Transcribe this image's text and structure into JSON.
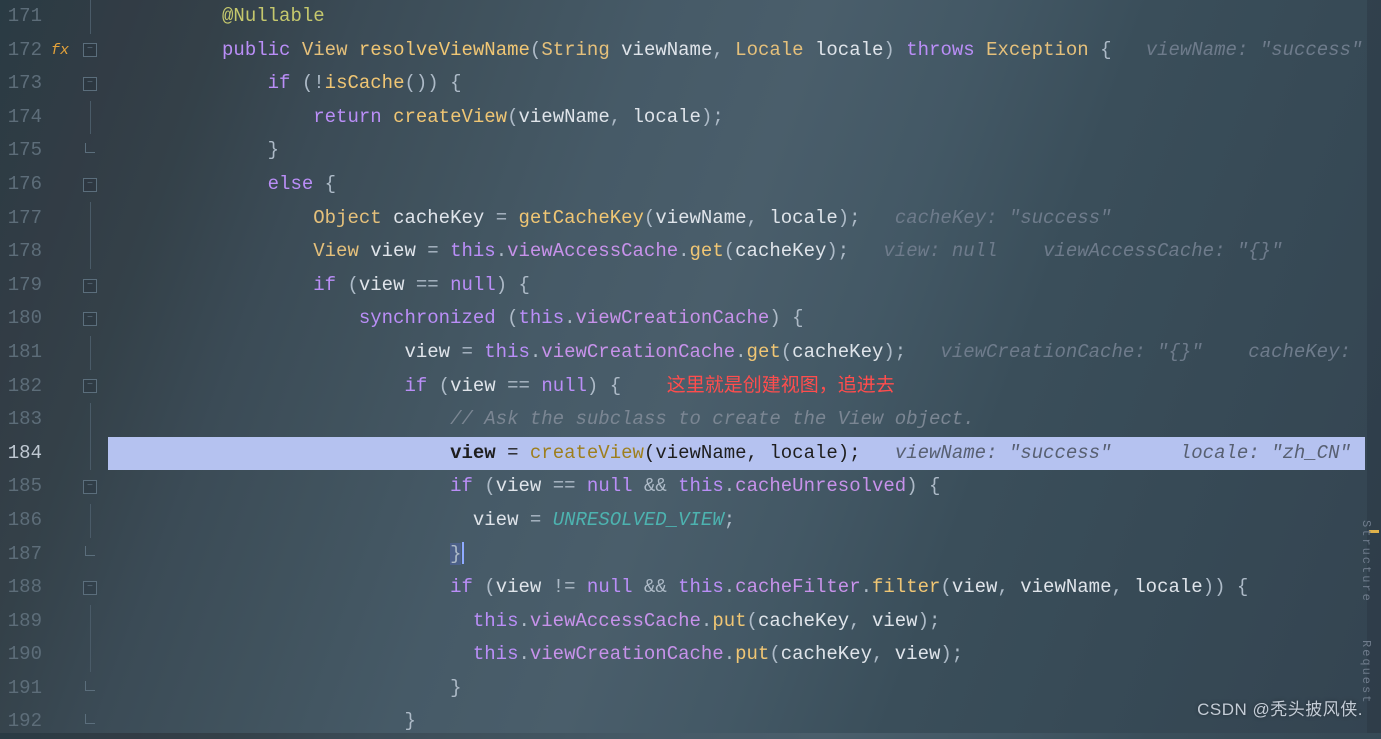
{
  "lines": [
    {
      "num": "171",
      "fold": "",
      "icon": "",
      "code_html": "          <span class='ann'>@Nullable</span>"
    },
    {
      "num": "172",
      "fold": "box",
      "icon": "fx",
      "code_html": "          <span class='kw'>public</span> <span class='type'>View</span> <span class='fn'>resolveViewName</span><span class='pun'>(</span><span class='type'>String</span> <span class='param'>viewName</span><span class='pun'>,</span> <span class='type'>Locale</span> <span class='param'>locale</span><span class='pun'>)</span> <span class='kw'>throws</span> <span class='type'>Exception</span> <span class='pun'>{</span>   <span class='hint'>viewName: &quot;success&quot;</span>"
    },
    {
      "num": "173",
      "fold": "box",
      "icon": "",
      "code_html": "              <span class='kw'>if</span> <span class='pun'>(!</span><span class='fn'>isCache</span><span class='pun'>()) {</span>"
    },
    {
      "num": "174",
      "fold": "",
      "icon": "",
      "code_html": "                  <span class='kw'>return</span> <span class='fn'>createView</span><span class='pun'>(</span><span class='param'>viewName</span><span class='pun'>,</span> <span class='param'>locale</span><span class='pun'>);</span>"
    },
    {
      "num": "175",
      "fold": "end",
      "icon": "",
      "code_html": "              <span class='pun'>}</span>"
    },
    {
      "num": "176",
      "fold": "box",
      "icon": "",
      "code_html": "              <span class='kw'>else</span> <span class='pun'>{</span>"
    },
    {
      "num": "177",
      "fold": "",
      "icon": "",
      "code_html": "                  <span class='type'>Object</span> <span class='param'>cacheKey</span> <span class='pun'>=</span> <span class='fn'>getCacheKey</span><span class='pun'>(</span><span class='param'>viewName</span><span class='pun'>,</span> <span class='param'>locale</span><span class='pun'>);</span>   <span class='hint'>cacheKey: &quot;success&quot;</span>"
    },
    {
      "num": "178",
      "fold": "",
      "icon": "",
      "code_html": "                  <span class='type'>View</span> <span class='param'>view</span> <span class='pun'>=</span> <span class='kw'>this</span><span class='pun'>.</span><span class='field'>viewAccessCache</span><span class='pun'>.</span><span class='fn'>get</span><span class='pun'>(</span><span class='param'>cacheKey</span><span class='pun'>);</span>   <span class='hint'>view: null    viewAccessCache: &quot;{}&quot;</span>"
    },
    {
      "num": "179",
      "fold": "box",
      "icon": "",
      "code_html": "                  <span class='kw'>if</span> <span class='pun'>(</span><span class='param'>view</span> <span class='pun'>==</span> <span class='kw'>null</span><span class='pun'>) {</span>"
    },
    {
      "num": "180",
      "fold": "box",
      "icon": "",
      "code_html": "                      <span class='kw'>synchronized</span> <span class='pun'>(</span><span class='kw'>this</span><span class='pun'>.</span><span class='field'>viewCreationCache</span><span class='pun'>) {</span>"
    },
    {
      "num": "181",
      "fold": "",
      "icon": "",
      "code_html": "                          <span class='param'>view</span> <span class='pun'>=</span> <span class='kw'>this</span><span class='pun'>.</span><span class='field'>viewCreationCache</span><span class='pun'>.</span><span class='fn'>get</span><span class='pun'>(</span><span class='param'>cacheKey</span><span class='pun'>);</span>   <span class='hint'>viewCreationCache: &quot;{}&quot;    cacheKey:</span>"
    },
    {
      "num": "182",
      "fold": "box",
      "icon": "",
      "code_html": "                          <span class='kw'>if</span> <span class='pun'>(</span><span class='param'>view</span> <span class='pun'>==</span> <span class='kw'>null</span><span class='pun'>) {</span>    <span class='red-note'>这里就是创建视图，追进去</span>"
    },
    {
      "num": "183",
      "fold": "",
      "icon": "",
      "code_html": "                              <span class='comment'>// Ask the subclass to create the View object.</span>"
    },
    {
      "num": "184",
      "fold": "",
      "icon": "",
      "current": true,
      "code_html": "                              <span class='param' style='font-weight:600'>view</span> <span class='pun'>=</span> <span class='fn'>createView</span><span class='pun'>(</span><span class='param'>viewName</span><span class='pun'>,</span> <span class='param'>locale</span><span class='pun'>);</span>   <span class='hint'>viewName: &quot;success&quot;      locale: &quot;zh_CN&quot;</span>"
    },
    {
      "num": "185",
      "fold": "box",
      "icon": "",
      "code_html": "                              <span class='kw'>if</span> <span class='pun'>(</span><span class='param'>view</span> <span class='pun'>==</span> <span class='kw'>null</span> <span class='pun'>&amp;&amp;</span> <span class='kw'>this</span><span class='pun'>.</span><span class='field'>cacheUnresolved</span><span class='pun'>) {</span>"
    },
    {
      "num": "186",
      "fold": "",
      "icon": "",
      "code_html": "                                <span class='param'>view</span> <span class='pun'>=</span> <span class='const'>UNRESOLVED_VIEW</span><span class='pun'>;</span>"
    },
    {
      "num": "187",
      "fold": "end",
      "icon": "",
      "code_html": "                              <span class='pun' style='background:rgba(90,110,200,.35)'>}</span><span style='display:inline-block;width:2px;height:22px;background:#8faaff;vertical-align:middle;margin-left:1px;'></span>"
    },
    {
      "num": "188",
      "fold": "box",
      "icon": "",
      "code_html": "                              <span class='kw'>if</span> <span class='pun'>(</span><span class='param'>view</span> <span class='pun'>!=</span> <span class='kw'>null</span> <span class='pun'>&amp;&amp;</span> <span class='kw'>this</span><span class='pun'>.</span><span class='field'>cacheFilter</span><span class='pun'>.</span><span class='fn'>filter</span><span class='pun'>(</span><span class='param'>view</span><span class='pun'>,</span> <span class='param'>viewName</span><span class='pun'>,</span> <span class='param'>locale</span><span class='pun'>)) {</span>"
    },
    {
      "num": "189",
      "fold": "",
      "icon": "",
      "code_html": "                                <span class='kw'>this</span><span class='pun'>.</span><span class='field'>viewAccessCache</span><span class='pun'>.</span><span class='fn'>put</span><span class='pun'>(</span><span class='param'>cacheKey</span><span class='pun'>,</span> <span class='param'>view</span><span class='pun'>);</span>"
    },
    {
      "num": "190",
      "fold": "",
      "icon": "",
      "code_html": "                                <span class='kw'>this</span><span class='pun'>.</span><span class='field'>viewCreationCache</span><span class='pun'>.</span><span class='fn'>put</span><span class='pun'>(</span><span class='param'>cacheKey</span><span class='pun'>,</span> <span class='param'>view</span><span class='pun'>);</span>"
    },
    {
      "num": "191",
      "fold": "end",
      "icon": "",
      "code_html": "                              <span class='pun'>}</span>"
    },
    {
      "num": "192",
      "fold": "end",
      "icon": "",
      "code_html": "                          <span class='pun'>}</span>"
    }
  ],
  "watermark": "CSDN @秃头披风侠.",
  "sidebar_labels": {
    "structure": "Structure",
    "request": "Request"
  },
  "gutter_icon_fx": "fx"
}
